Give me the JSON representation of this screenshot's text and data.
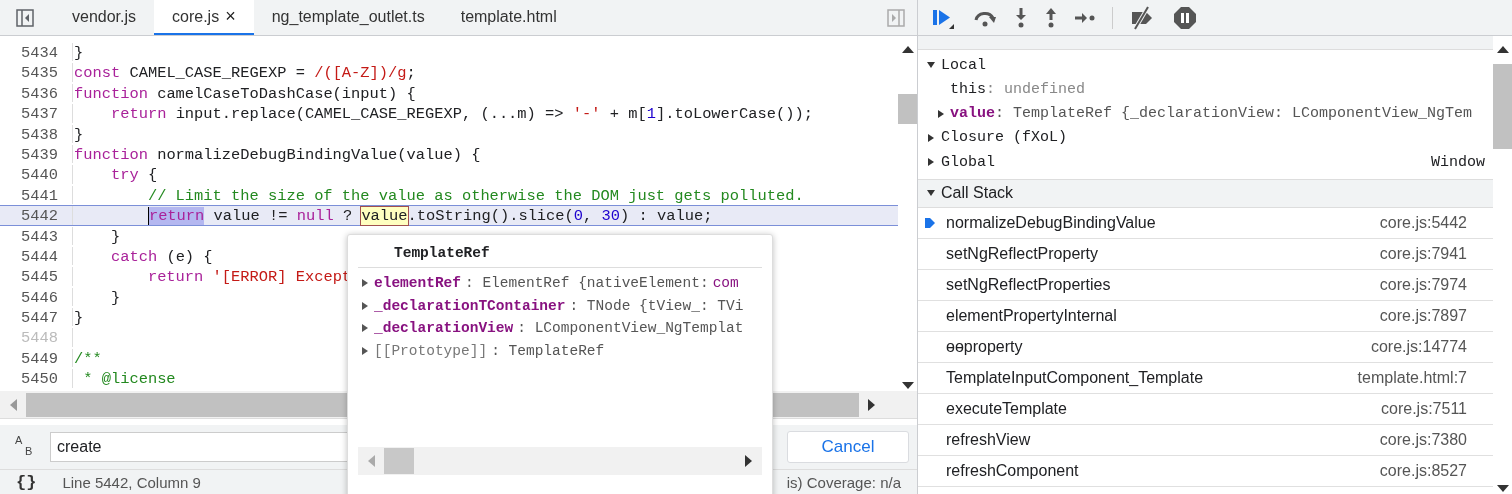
{
  "editor_tabs": [
    {
      "label": "vendor.js",
      "selected": false
    },
    {
      "label": "core.js",
      "selected": true,
      "close": "×"
    },
    {
      "label": "ng_template_outlet.ts",
      "selected": false
    },
    {
      "label": "template.html",
      "selected": false
    }
  ],
  "code": [
    {
      "number": "5434",
      "current": false,
      "tokens": [
        {
          "kind": "plain",
          "text": "}"
        }
      ]
    },
    {
      "number": "5435",
      "current": false,
      "tokens": [
        {
          "kind": "kw",
          "text": "const"
        },
        {
          "kind": "plain",
          "text": " CAMEL_CASE_REGEXP = "
        },
        {
          "kind": "str",
          "text": "/([A-Z])/g"
        },
        {
          "kind": "plain",
          "text": ";"
        }
      ]
    },
    {
      "number": "5436",
      "current": false,
      "tokens": [
        {
          "kind": "kw",
          "text": "function"
        },
        {
          "kind": "plain",
          "text": " camelCaseToDashCase(input) {"
        }
      ]
    },
    {
      "number": "5437",
      "current": false,
      "tokens": [
        {
          "kind": "kw",
          "text": "    return"
        },
        {
          "kind": "plain",
          "text": " input.replace(CAMEL_CASE_REGEXP, (...m) => "
        },
        {
          "kind": "str",
          "text": "'-'"
        },
        {
          "kind": "plain",
          "text": " + m["
        },
        {
          "kind": "num",
          "text": "1"
        },
        {
          "kind": "plain",
          "text": "].toLowerCase());"
        }
      ]
    },
    {
      "number": "5438",
      "current": false,
      "tokens": [
        {
          "kind": "plain",
          "text": "}"
        }
      ]
    },
    {
      "number": "5439",
      "current": false,
      "tokens": [
        {
          "kind": "kw",
          "text": "function"
        },
        {
          "kind": "plain",
          "text": " normalizeDebugBindingValue(value) {"
        }
      ]
    },
    {
      "number": "5440",
      "current": false,
      "tokens": [
        {
          "kind": "kw",
          "text": "    try"
        },
        {
          "kind": "plain",
          "text": " {"
        }
      ]
    },
    {
      "number": "5441",
      "current": false,
      "tokens": [
        {
          "kind": "cmt",
          "text": "        // Limit the size of the value as otherwise the DOM just gets polluted."
        }
      ]
    },
    {
      "number": "5442",
      "current": true,
      "tokens": [
        {
          "kind": "sel",
          "text": "        return"
        },
        {
          "kind": "plain",
          "text": " value != "
        },
        {
          "kind": "kw",
          "text": "null"
        },
        {
          "kind": "plain",
          "text": " ? "
        },
        {
          "kind": "hover",
          "text": "value"
        },
        {
          "kind": "plain",
          "text": ".toString().slice("
        },
        {
          "kind": "num",
          "text": "0"
        },
        {
          "kind": "plain",
          "text": ", "
        },
        {
          "kind": "num",
          "text": "30"
        },
        {
          "kind": "plain",
          "text": ") : value;"
        }
      ]
    },
    {
      "number": "5443",
      "current": false,
      "tokens": [
        {
          "kind": "plain",
          "text": "    }"
        }
      ]
    },
    {
      "number": "5444",
      "current": false,
      "tokens": [
        {
          "kind": "kw",
          "text": "    catch"
        },
        {
          "kind": "plain",
          "text": " (e) {"
        }
      ]
    },
    {
      "number": "5445",
      "current": false,
      "tokens": [
        {
          "kind": "kw",
          "text": "        return"
        },
        {
          "kind": "str",
          "text": " '[ERROR] Except"
        }
      ]
    },
    {
      "number": "5446",
      "current": false,
      "tokens": [
        {
          "kind": "plain",
          "text": "    }"
        }
      ]
    },
    {
      "number": "5447",
      "current": false,
      "tokens": [
        {
          "kind": "plain",
          "text": "}"
        }
      ]
    },
    {
      "number": "5448",
      "current": false
    },
    {
      "number": "5449",
      "current": false,
      "tokens": [
        {
          "kind": "cmt",
          "text": "/**"
        }
      ]
    },
    {
      "number": "5450",
      "current": false,
      "tokens": [
        {
          "kind": "cmt",
          "text": " * @license"
        }
      ]
    }
  ],
  "popover": {
    "title": "TemplateRef",
    "properties": [
      {
        "key": "elementRef",
        "value": ": ElementRef {nativeElement: ",
        "tail": "com",
        "internal": false
      },
      {
        "key": "_declarationTContainer",
        "value": ": TNode {tView_: TVi",
        "internal": false
      },
      {
        "key": "_declarationView",
        "value": ": LComponentView_NgTemplat",
        "internal": false
      },
      {
        "key": "[[Prototype]]",
        "value": ": TemplateRef",
        "internal": true
      }
    ]
  },
  "search": {
    "toggle": [
      "A",
      "B"
    ],
    "value": "create",
    "cancel": "Cancel"
  },
  "status_bar": {
    "pretty_print": "{}",
    "position": "Line 5442, Column 9",
    "coverage": "is) Coverage: n/a"
  },
  "scope": [
    {
      "label": "Local",
      "expanded": true,
      "children": [
        {
          "key": "this",
          "value": ": undefined",
          "expandable": false,
          "dim": true
        },
        {
          "key": "value",
          "value": ": TemplateRef {_declarationView: LComponentView_NgTem",
          "expandable": true,
          "dim": false
        }
      ]
    },
    {
      "label": "Closure (fXoL)",
      "expanded": false
    },
    {
      "label": "Global",
      "expanded": false,
      "value": "Window"
    }
  ],
  "call_stack": {
    "title": "Call Stack",
    "expanded": true,
    "frames": [
      {
        "name": "normalizeDebugBindingValue",
        "location": "core.js:5442",
        "current": true
      },
      {
        "name": "setNgReflectProperty",
        "location": "core.js:7941",
        "current": false
      },
      {
        "name": "setNgReflectProperties",
        "location": "core.js:7974",
        "current": false
      },
      {
        "name": "elementPropertyInternal",
        "location": "core.js:7897",
        "current": false
      },
      {
        "name": "ɵɵproperty",
        "location": "core.js:14774",
        "current": false
      },
      {
        "name": "TemplateInputComponent_Template",
        "location": "template.html:7",
        "current": false
      },
      {
        "name": "executeTemplate",
        "location": "core.js:7511",
        "current": false
      },
      {
        "name": "refreshView",
        "location": "core.js:7380",
        "current": false
      },
      {
        "name": "refreshComponent",
        "location": "core.js:8527",
        "current": false
      }
    ]
  }
}
